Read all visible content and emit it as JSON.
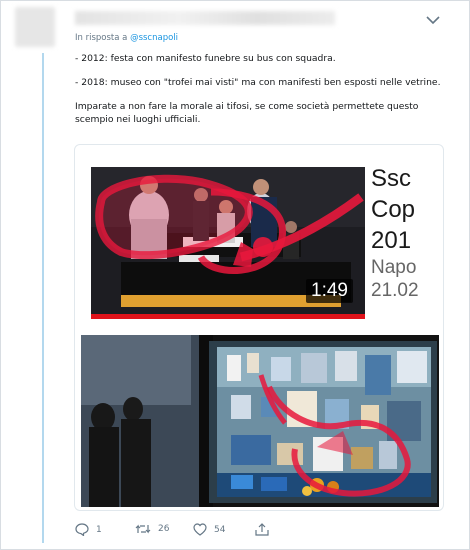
{
  "reply": {
    "prefix": "In risposta a",
    "handle": "@sscnapoli"
  },
  "tweet": {
    "line1": "- 2012: festa con manifesto funebre su bus con squadra.",
    "line2": "- 2018: museo con \"trofei mai visti\" ma con manifesti ben esposti nelle vetrine.",
    "line3": "Imparate a non fare la morale ai tifosi, se come società permettete questo",
    "line4": "scempio nei luoghi ufficiali."
  },
  "video": {
    "duration": "1:49",
    "title_line1": "Ssc",
    "title_line2": "Cop",
    "title_line3": "201",
    "sub_line1": "Napo",
    "sub_line2": "21.02"
  },
  "actions": {
    "replies": "1",
    "retweets": "26",
    "likes": "54"
  },
  "icons": {
    "menu": "chevron-down-icon",
    "reply": "reply-icon",
    "retweet": "retweet-icon",
    "like": "heart-icon",
    "share": "share-icon"
  },
  "colors": {
    "link": "#1b95e0",
    "thread_line": "#b3d8ee",
    "annotation_red": "#e8183c",
    "meta_text": "#657786"
  }
}
